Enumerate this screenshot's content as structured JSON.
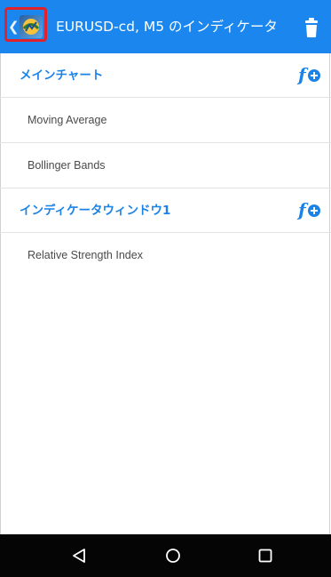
{
  "header": {
    "title": "EURUSD-cd, M5 のインディケータ",
    "back_icon": "chevron-left-icon",
    "logo_icon": "metatrader-logo-icon",
    "delete_icon": "trash-icon"
  },
  "sections": [
    {
      "title": "メインチャート",
      "add_icon": "add-function-icon",
      "items": [
        "Moving Average",
        "Bollinger Bands"
      ]
    },
    {
      "title": "インディケータウィンドウ1",
      "add_icon": "add-function-icon",
      "items": [
        "Relative Strength Index"
      ]
    }
  ],
  "navbar": {
    "back_icon": "nav-back-triangle-icon",
    "home_icon": "nav-home-circle-icon",
    "recents_icon": "nav-recents-square-icon"
  },
  "colors": {
    "appbar": "#1b87ee",
    "accent": "#1b82e6",
    "highlight": "#e1222b",
    "navbar": "#050505"
  }
}
